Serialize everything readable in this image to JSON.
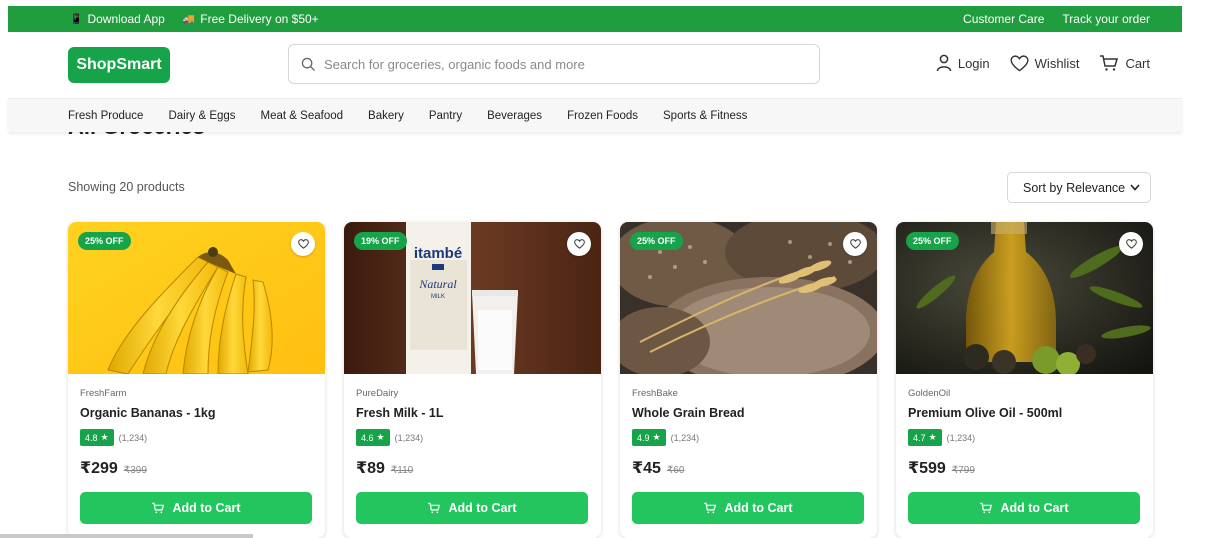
{
  "topbar": {
    "download_app": "Download App",
    "free_delivery": "Free Delivery on $50+",
    "customer_care": "Customer Care",
    "track_order": "Track your order"
  },
  "header": {
    "logo": "ShopSmart",
    "search_placeholder": "Search for groceries, organic foods and more",
    "login": "Login",
    "wishlist": "Wishlist",
    "cart": "Cart"
  },
  "categories": [
    "Fresh Produce",
    "Dairy & Eggs",
    "Meat & Seafood",
    "Bakery",
    "Pantry",
    "Beverages",
    "Frozen Foods",
    "Sports & Fitness"
  ],
  "main": {
    "title": "All Groceries",
    "count": "Showing 20 products",
    "sort_label": "Sort by Relevance"
  },
  "products": [
    {
      "discount": "25% OFF",
      "brand": "FreshFarm",
      "name": "Organic Bananas - 1kg",
      "rating": "4.8",
      "reviews": "(1,234)",
      "price": "₹299",
      "mrp": "₹399",
      "button": "Add to Cart",
      "image": "bananas"
    },
    {
      "discount": "19% OFF",
      "brand": "PureDairy",
      "name": "Fresh Milk - 1L",
      "rating": "4.6",
      "reviews": "(1,234)",
      "price": "₹89",
      "mrp": "₹110",
      "button": "Add to Cart",
      "image": "milk",
      "label_brand": "itambé",
      "label_product": "Natural",
      "label_milk": "MILK"
    },
    {
      "discount": "25% OFF",
      "brand": "FreshBake",
      "name": "Whole Grain Bread",
      "rating": "4.9",
      "reviews": "(1,234)",
      "price": "₹45",
      "mrp": "₹60",
      "button": "Add to Cart",
      "image": "bread"
    },
    {
      "discount": "25% OFF",
      "brand": "GoldenOil",
      "name": "Premium Olive Oil - 500ml",
      "rating": "4.7",
      "reviews": "(1,234)",
      "price": "₹599",
      "mrp": "₹799",
      "button": "Add to Cart",
      "image": "olive-oil"
    }
  ],
  "colors": {
    "brand_green": "#16a34a",
    "topbar_green": "#1f9d3f",
    "button_green": "#22c55e"
  },
  "icons": [
    "phone-icon",
    "truck-icon",
    "search-icon",
    "user-icon",
    "heart-icon",
    "cart-icon",
    "chevron-down-icon",
    "star-icon"
  ]
}
